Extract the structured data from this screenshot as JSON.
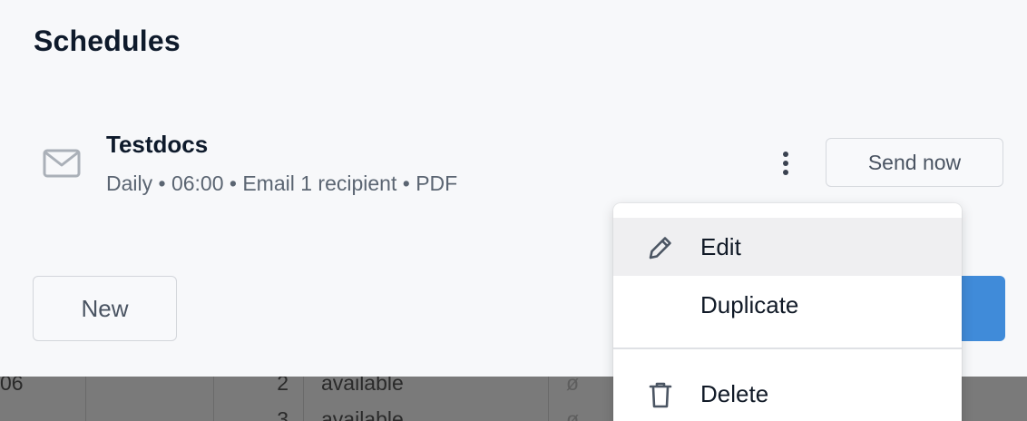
{
  "panel": {
    "title": "Schedules"
  },
  "schedule": {
    "icon": "mail-icon",
    "name": "Testdocs",
    "meta": "Daily • 06:00 • Email 1 recipient • PDF",
    "send_now_label": "Send now",
    "more_icon": "kebab-menu-icon"
  },
  "actions": {
    "new_label": "New"
  },
  "menu": {
    "items": [
      {
        "label": "Edit",
        "icon": "pencil-icon"
      },
      {
        "label": "Duplicate",
        "icon": ""
      },
      {
        "label": "Delete",
        "icon": "trash-icon"
      }
    ]
  },
  "background_table": {
    "rows": [
      {
        "id_fragment": "06",
        "num": "2",
        "status": "available",
        "mark": "ø"
      },
      {
        "id_fragment": "",
        "num": "3",
        "status": "available",
        "mark": "ø"
      }
    ]
  },
  "colors": {
    "panel_bg": "#f7f8fa",
    "primary": "#408bd9",
    "text_dark": "#0e1a2b",
    "text_muted": "#5b6572",
    "overlay": "#7a7a7a"
  }
}
